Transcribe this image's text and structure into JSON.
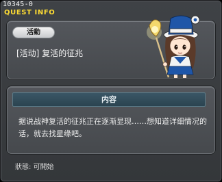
{
  "window": {
    "quest_id": "10345-0",
    "title": "QUEST INFO"
  },
  "quest": {
    "category_label": "活動",
    "name": "[活动] 复活的征兆",
    "npc_icon": "npc-portrait-icon"
  },
  "content": {
    "header_label": "内容",
    "description": "据说战神复活的征兆正在逐渐显现……想知道详细情况的话，就去找星缘吧。"
  },
  "status": {
    "text": "狀態:  可開始"
  },
  "colors": {
    "title": "#ffdd33",
    "panel": "#4d5055",
    "content_bar": "#334d5a"
  }
}
